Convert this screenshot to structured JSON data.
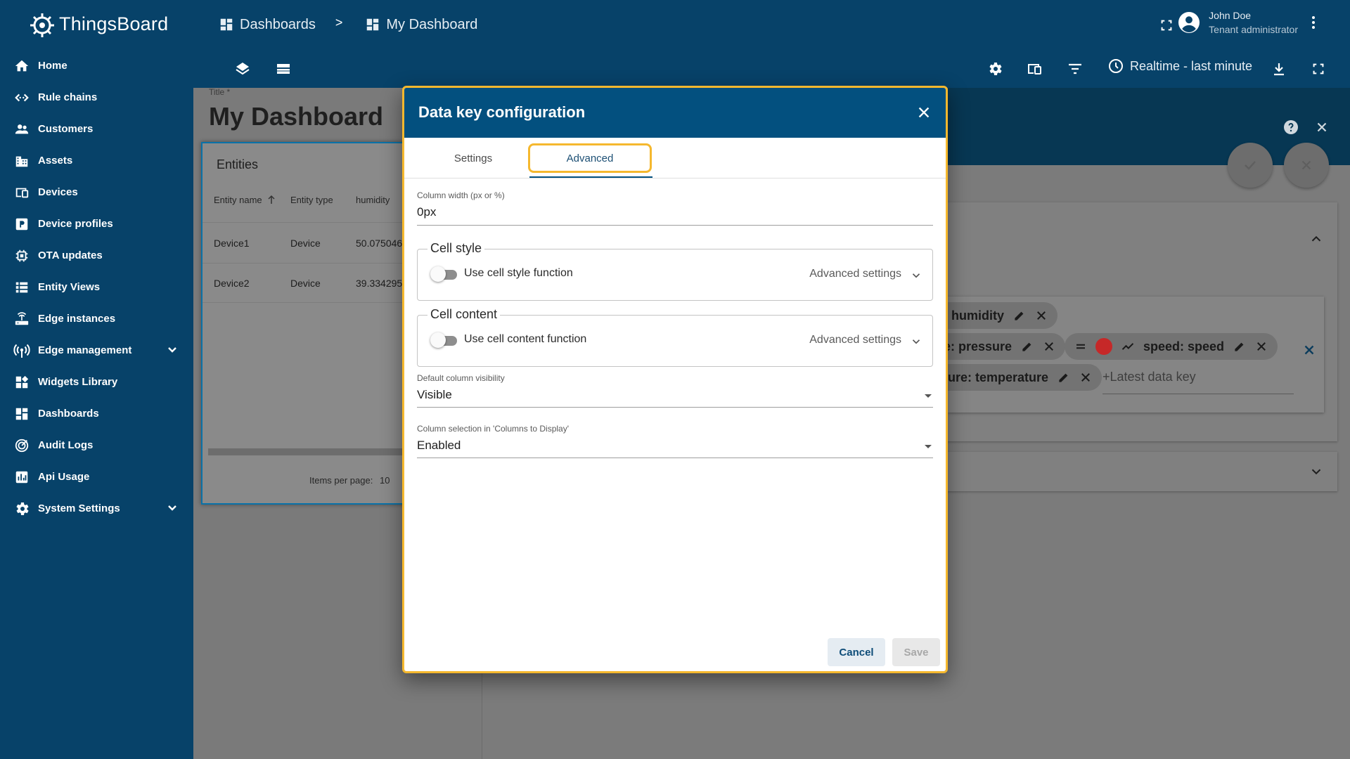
{
  "app": {
    "name": "ThingsBoard"
  },
  "sidebar": {
    "items": [
      {
        "label": "Home",
        "icon": "home-icon"
      },
      {
        "label": "Rule chains",
        "icon": "rule-chains-icon"
      },
      {
        "label": "Customers",
        "icon": "customers-icon"
      },
      {
        "label": "Assets",
        "icon": "assets-icon"
      },
      {
        "label": "Devices",
        "icon": "devices-icon"
      },
      {
        "label": "Device profiles",
        "icon": "device-profiles-icon"
      },
      {
        "label": "OTA updates",
        "icon": "ota-updates-icon"
      },
      {
        "label": "Entity Views",
        "icon": "entity-views-icon"
      },
      {
        "label": "Edge instances",
        "icon": "edge-instances-icon"
      },
      {
        "label": "Edge management",
        "icon": "edge-management-icon"
      },
      {
        "label": "Widgets Library",
        "icon": "widgets-library-icon"
      },
      {
        "label": "Dashboards",
        "icon": "dashboards-icon"
      },
      {
        "label": "Audit Logs",
        "icon": "audit-logs-icon"
      },
      {
        "label": "Api Usage",
        "icon": "api-usage-icon"
      },
      {
        "label": "System Settings",
        "icon": "system-settings-icon"
      }
    ]
  },
  "header": {
    "breadcrumbs": [
      {
        "label": "Dashboards"
      },
      {
        "label": "My Dashboard"
      }
    ],
    "separator": ">",
    "user": {
      "name": "John Doe",
      "role": "Tenant administrator"
    },
    "timewindow": "Realtime - last minute"
  },
  "dashboard": {
    "title_label": "Title *",
    "title": "My Dashboard",
    "widget": {
      "title": "Entities",
      "columns": [
        "Entity name",
        "Entity type",
        "humidity"
      ],
      "rows": [
        [
          "Device1",
          "Device",
          "50.075046"
        ],
        [
          "Device2",
          "Device",
          "39.334295"
        ]
      ],
      "items_per_page_label": "Items per page:",
      "items_per_page_value": "10"
    }
  },
  "right_panel": {
    "chips": [
      {
        "label": ": humidity"
      },
      {
        "label": "e: pressure"
      },
      {
        "label": "speed: speed",
        "color": "#c62828"
      },
      {
        "label": "ture: temperature"
      }
    ],
    "latest_placeholder": "+Latest data key"
  },
  "dialog": {
    "title": "Data key configuration",
    "tabs": [
      "Settings",
      "Advanced"
    ],
    "active_tab": "Advanced",
    "column_width": {
      "label": "Column width (px or %)",
      "value": "0px"
    },
    "cell_style": {
      "legend": "Cell style",
      "toggle_label": "Use cell style function",
      "advanced": "Advanced settings"
    },
    "cell_content": {
      "legend": "Cell content",
      "toggle_label": "Use cell content function",
      "advanced": "Advanced settings"
    },
    "visibility": {
      "label": "Default column visibility",
      "value": "Visible"
    },
    "selection": {
      "label": "Column selection in 'Columns to Display'",
      "value": "Enabled"
    },
    "cancel_label": "Cancel",
    "save_label": "Save"
  },
  "colors": {
    "primary": "#074269",
    "dialog_header": "#03507f",
    "focus_outline": "#f5b82e"
  }
}
